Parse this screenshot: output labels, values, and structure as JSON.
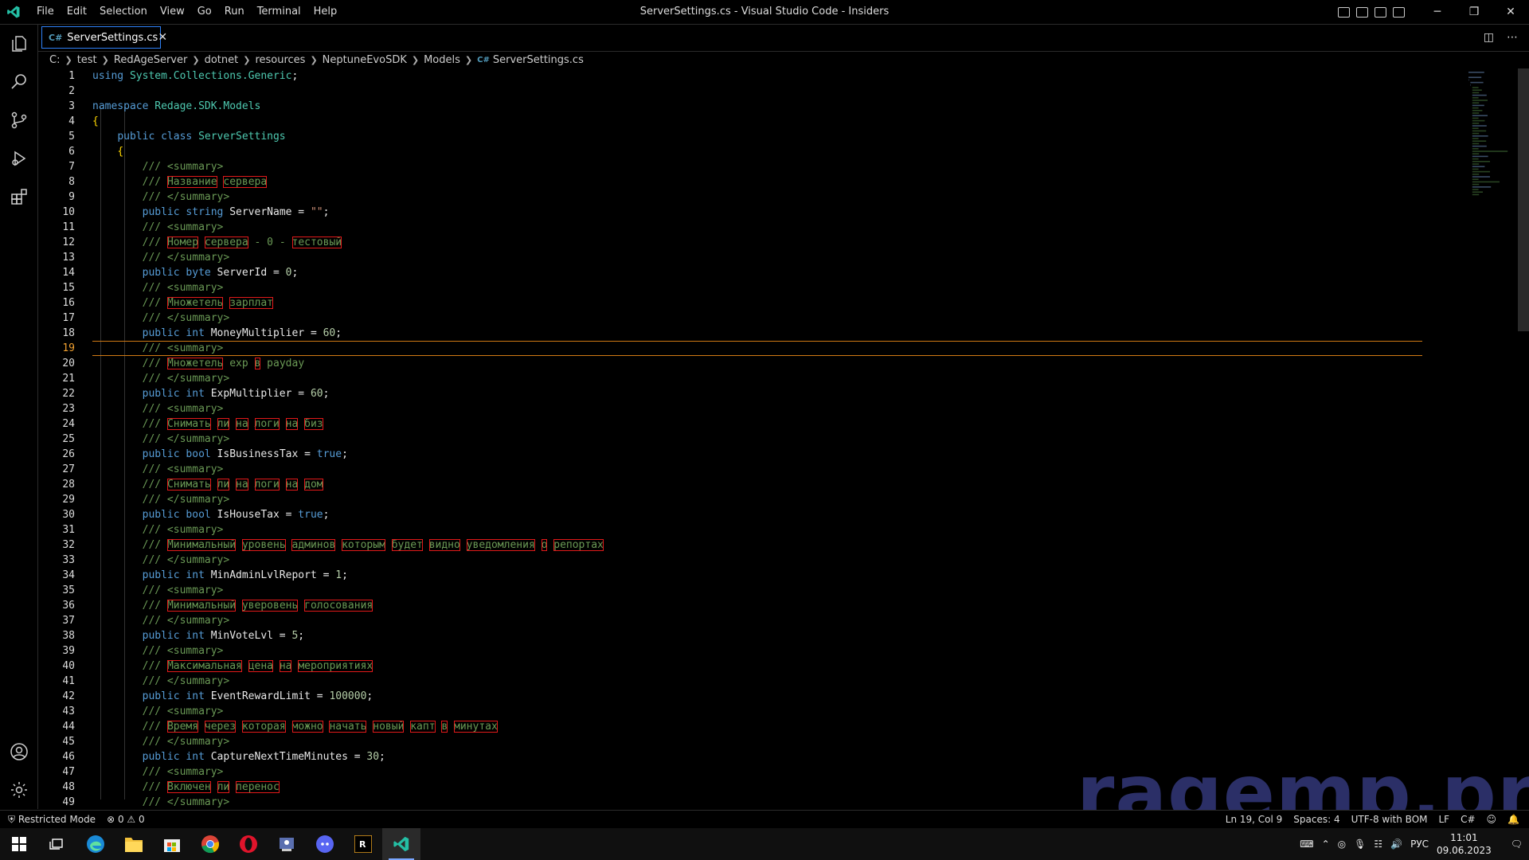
{
  "window": {
    "title": "ServerSettings.cs - Visual Studio Code - Insiders"
  },
  "menu": [
    "File",
    "Edit",
    "Selection",
    "View",
    "Go",
    "Run",
    "Terminal",
    "Help"
  ],
  "tab": {
    "label": "ServerSettings.cs",
    "icon": "csharp-file-icon"
  },
  "breadcrumb": [
    "C:",
    "test",
    "RedAgeServer",
    "dotnet",
    "resources",
    "NeptuneEvoSDK",
    "Models",
    "ServerSettings.cs"
  ],
  "editor": {
    "current_line": 19,
    "lines": [
      [
        [
          "kw",
          "using "
        ],
        [
          "ty",
          "System.Collections.Generic"
        ],
        [
          "id",
          ";"
        ]
      ],
      [],
      [
        [
          "kw",
          "namespace "
        ],
        [
          "ty",
          "Redage.SDK.Models"
        ]
      ],
      [
        [
          "br",
          "{"
        ]
      ],
      [
        [
          "i",
          "    "
        ],
        [
          "kw",
          "public class "
        ],
        [
          "ty",
          "ServerSettings"
        ]
      ],
      [
        [
          "i",
          "    "
        ],
        [
          "br",
          "{"
        ]
      ],
      [
        [
          "i",
          "        "
        ],
        [
          "cm",
          "/// <summary>"
        ]
      ],
      [
        [
          "i",
          "        "
        ],
        [
          "cm",
          "/// "
        ],
        [
          "cmw",
          "Название"
        ],
        [
          "cm",
          " "
        ],
        [
          "cmw",
          "сервера"
        ]
      ],
      [
        [
          "i",
          "        "
        ],
        [
          "cm",
          "/// </summary>"
        ]
      ],
      [
        [
          "i",
          "        "
        ],
        [
          "kw",
          "public string "
        ],
        [
          "id",
          "ServerName = "
        ],
        [
          "st",
          "\"\""
        ],
        [
          "id",
          ";"
        ]
      ],
      [
        [
          "i",
          "        "
        ],
        [
          "cm",
          "/// <summary>"
        ]
      ],
      [
        [
          "i",
          "        "
        ],
        [
          "cm",
          "/// "
        ],
        [
          "cmw",
          "Номер"
        ],
        [
          "cm",
          " "
        ],
        [
          "cmw",
          "сервера"
        ],
        [
          "cm",
          " - 0 - "
        ],
        [
          "cmw",
          "тестовый"
        ]
      ],
      [
        [
          "i",
          "        "
        ],
        [
          "cm",
          "/// </summary>"
        ]
      ],
      [
        [
          "i",
          "        "
        ],
        [
          "kw",
          "public byte "
        ],
        [
          "id",
          "ServerId = "
        ],
        [
          "nm",
          "0"
        ],
        [
          "id",
          ";"
        ]
      ],
      [
        [
          "i",
          "        "
        ],
        [
          "cm",
          "/// <summary>"
        ]
      ],
      [
        [
          "i",
          "        "
        ],
        [
          "cm",
          "/// "
        ],
        [
          "cmw",
          "Множетель"
        ],
        [
          "cm",
          " "
        ],
        [
          "cmw",
          "зарплат"
        ]
      ],
      [
        [
          "i",
          "        "
        ],
        [
          "cm",
          "/// </summary>"
        ]
      ],
      [
        [
          "i",
          "        "
        ],
        [
          "kw",
          "public int "
        ],
        [
          "id",
          "MoneyMultiplier = "
        ],
        [
          "nm",
          "60"
        ],
        [
          "id",
          ";"
        ]
      ],
      [
        [
          "i",
          "        "
        ],
        [
          "cm",
          "/// <summary>"
        ]
      ],
      [
        [
          "i",
          "        "
        ],
        [
          "cm",
          "/// "
        ],
        [
          "cmw",
          "Множетель"
        ],
        [
          "cm",
          " exp "
        ],
        [
          "cmw",
          "в"
        ],
        [
          "cm",
          " payday"
        ]
      ],
      [
        [
          "i",
          "        "
        ],
        [
          "cm",
          "/// </summary>"
        ]
      ],
      [
        [
          "i",
          "        "
        ],
        [
          "kw",
          "public int "
        ],
        [
          "id",
          "ExpMultiplier = "
        ],
        [
          "nm",
          "60"
        ],
        [
          "id",
          ";"
        ]
      ],
      [
        [
          "i",
          "        "
        ],
        [
          "cm",
          "/// <summary>"
        ]
      ],
      [
        [
          "i",
          "        "
        ],
        [
          "cm",
          "/// "
        ],
        [
          "cmw",
          "Снимать"
        ],
        [
          "cm",
          " "
        ],
        [
          "cmw",
          "ли"
        ],
        [
          "cm",
          " "
        ],
        [
          "cmw",
          "на"
        ],
        [
          "cm",
          " "
        ],
        [
          "cmw",
          "логи"
        ],
        [
          "cm",
          " "
        ],
        [
          "cmw",
          "на"
        ],
        [
          "cm",
          " "
        ],
        [
          "cmw",
          "биз"
        ]
      ],
      [
        [
          "i",
          "        "
        ],
        [
          "cm",
          "/// </summary>"
        ]
      ],
      [
        [
          "i",
          "        "
        ],
        [
          "kw",
          "public bool "
        ],
        [
          "id",
          "IsBusinessTax = "
        ],
        [
          "kw",
          "true"
        ],
        [
          "id",
          ";"
        ]
      ],
      [
        [
          "i",
          "        "
        ],
        [
          "cm",
          "/// <summary>"
        ]
      ],
      [
        [
          "i",
          "        "
        ],
        [
          "cm",
          "/// "
        ],
        [
          "cmw",
          "Снимать"
        ],
        [
          "cm",
          " "
        ],
        [
          "cmw",
          "ли"
        ],
        [
          "cm",
          " "
        ],
        [
          "cmw",
          "на"
        ],
        [
          "cm",
          " "
        ],
        [
          "cmw",
          "логи"
        ],
        [
          "cm",
          " "
        ],
        [
          "cmw",
          "на"
        ],
        [
          "cm",
          " "
        ],
        [
          "cmw",
          "дом"
        ]
      ],
      [
        [
          "i",
          "        "
        ],
        [
          "cm",
          "/// </summary>"
        ]
      ],
      [
        [
          "i",
          "        "
        ],
        [
          "kw",
          "public bool "
        ],
        [
          "id",
          "IsHouseTax = "
        ],
        [
          "kw",
          "true"
        ],
        [
          "id",
          ";"
        ]
      ],
      [
        [
          "i",
          "        "
        ],
        [
          "cm",
          "/// <summary>"
        ]
      ],
      [
        [
          "i",
          "        "
        ],
        [
          "cm",
          "/// "
        ],
        [
          "cmw",
          "Минимальный"
        ],
        [
          "cm",
          " "
        ],
        [
          "cmw",
          "уровень"
        ],
        [
          "cm",
          " "
        ],
        [
          "cmw",
          "админов"
        ],
        [
          "cm",
          " "
        ],
        [
          "cmw",
          "которым"
        ],
        [
          "cm",
          " "
        ],
        [
          "cmw",
          "будет"
        ],
        [
          "cm",
          " "
        ],
        [
          "cmw",
          "видно"
        ],
        [
          "cm",
          " "
        ],
        [
          "cmw",
          "уведомления"
        ],
        [
          "cm",
          " "
        ],
        [
          "cmw",
          "о"
        ],
        [
          "cm",
          " "
        ],
        [
          "cmw",
          "репортах"
        ]
      ],
      [
        [
          "i",
          "        "
        ],
        [
          "cm",
          "/// </summary>"
        ]
      ],
      [
        [
          "i",
          "        "
        ],
        [
          "kw",
          "public int "
        ],
        [
          "id",
          "MinAdminLvlReport = "
        ],
        [
          "nm",
          "1"
        ],
        [
          "id",
          ";"
        ]
      ],
      [
        [
          "i",
          "        "
        ],
        [
          "cm",
          "/// <summary>"
        ]
      ],
      [
        [
          "i",
          "        "
        ],
        [
          "cm",
          "/// "
        ],
        [
          "cmw",
          "Минимальный"
        ],
        [
          "cm",
          " "
        ],
        [
          "cmw",
          "уверовень"
        ],
        [
          "cm",
          " "
        ],
        [
          "cmw",
          "голосования"
        ]
      ],
      [
        [
          "i",
          "        "
        ],
        [
          "cm",
          "/// </summary>"
        ]
      ],
      [
        [
          "i",
          "        "
        ],
        [
          "kw",
          "public int "
        ],
        [
          "id",
          "MinVoteLvl = "
        ],
        [
          "nm",
          "5"
        ],
        [
          "id",
          ";"
        ]
      ],
      [
        [
          "i",
          "        "
        ],
        [
          "cm",
          "/// <summary>"
        ]
      ],
      [
        [
          "i",
          "        "
        ],
        [
          "cm",
          "/// "
        ],
        [
          "cmw",
          "Максимальная"
        ],
        [
          "cm",
          " "
        ],
        [
          "cmw",
          "цена"
        ],
        [
          "cm",
          " "
        ],
        [
          "cmw",
          "на"
        ],
        [
          "cm",
          " "
        ],
        [
          "cmw",
          "мероприятиях"
        ]
      ],
      [
        [
          "i",
          "        "
        ],
        [
          "cm",
          "/// </summary>"
        ]
      ],
      [
        [
          "i",
          "        "
        ],
        [
          "kw",
          "public int "
        ],
        [
          "id",
          "EventRewardLimit = "
        ],
        [
          "nm",
          "100000"
        ],
        [
          "id",
          ";"
        ]
      ],
      [
        [
          "i",
          "        "
        ],
        [
          "cm",
          "/// <summary>"
        ]
      ],
      [
        [
          "i",
          "        "
        ],
        [
          "cm",
          "/// "
        ],
        [
          "cmw",
          "Время"
        ],
        [
          "cm",
          " "
        ],
        [
          "cmw",
          "через"
        ],
        [
          "cm",
          " "
        ],
        [
          "cmw",
          "которая"
        ],
        [
          "cm",
          " "
        ],
        [
          "cmw",
          "можно"
        ],
        [
          "cm",
          " "
        ],
        [
          "cmw",
          "начать"
        ],
        [
          "cm",
          " "
        ],
        [
          "cmw",
          "новый"
        ],
        [
          "cm",
          " "
        ],
        [
          "cmw",
          "капт"
        ],
        [
          "cm",
          " "
        ],
        [
          "cmw",
          "в"
        ],
        [
          "cm",
          " "
        ],
        [
          "cmw",
          "минутах"
        ]
      ],
      [
        [
          "i",
          "        "
        ],
        [
          "cm",
          "/// </summary>"
        ]
      ],
      [
        [
          "i",
          "        "
        ],
        [
          "kw",
          "public int "
        ],
        [
          "id",
          "CaptureNextTimeMinutes = "
        ],
        [
          "nm",
          "30"
        ],
        [
          "id",
          ";"
        ]
      ],
      [
        [
          "i",
          "        "
        ],
        [
          "cm",
          "/// <summary>"
        ]
      ],
      [
        [
          "i",
          "        "
        ],
        [
          "cm",
          "/// "
        ],
        [
          "cmw",
          "Включен"
        ],
        [
          "cm",
          " "
        ],
        [
          "cmw",
          "ли"
        ],
        [
          "cm",
          " "
        ],
        [
          "cmw",
          "перенос"
        ]
      ],
      [
        [
          "i",
          "        "
        ],
        [
          "cm",
          "/// </summary>"
        ]
      ]
    ]
  },
  "watermark": "ragemp.pro",
  "status": {
    "mode": "Restricted Mode",
    "errors": "0",
    "warnings": "0",
    "position": "Ln 19, Col 9",
    "spaces": "Spaces: 4",
    "encoding": "UTF-8 with BOM",
    "eol": "LF",
    "language": "C#"
  },
  "taskbar": {
    "lang": "РУС",
    "time": "11:01",
    "date": "09.06.2023"
  },
  "colors": {
    "accent": "#2f81f7",
    "current_line_border": "#d07a14",
    "spell_error": "#e21a1a"
  }
}
